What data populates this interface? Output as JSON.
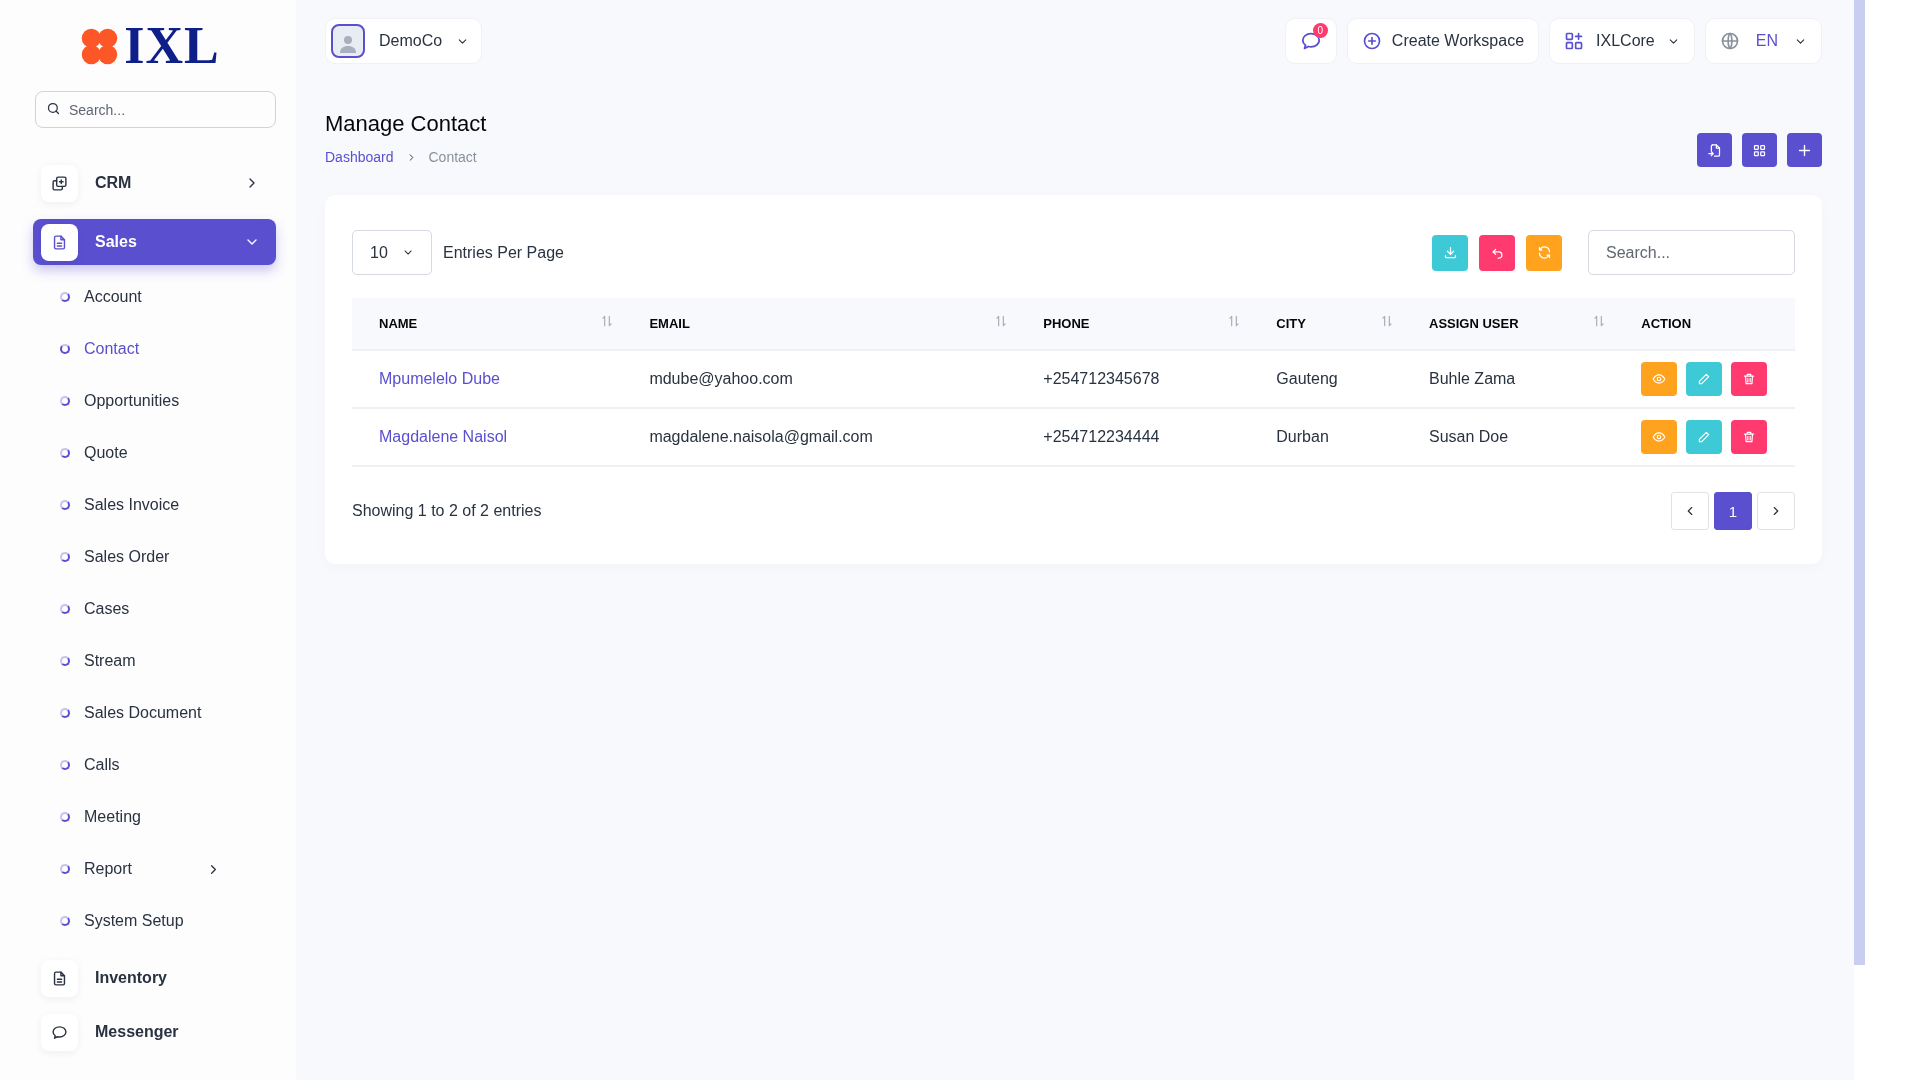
{
  "logo": {
    "text": "IXL"
  },
  "sidebar": {
    "search": {
      "placeholder": "Search..."
    },
    "items": [
      {
        "kind": "module",
        "label": "CRM",
        "selected": false,
        "expanded": false
      },
      {
        "kind": "module",
        "label": "Sales",
        "selected": true,
        "expanded": true,
        "children": [
          {
            "label": "Account",
            "selected": false,
            "has_submenu": false
          },
          {
            "label": "Contact",
            "selected": true,
            "has_submenu": false
          },
          {
            "label": "Opportunities",
            "selected": false,
            "has_submenu": false
          },
          {
            "label": "Quote",
            "selected": false,
            "has_submenu": false
          },
          {
            "label": "Sales Invoice",
            "selected": false,
            "has_submenu": false
          },
          {
            "label": "Sales Order",
            "selected": false,
            "has_submenu": false
          },
          {
            "label": "Cases",
            "selected": false,
            "has_submenu": false
          },
          {
            "label": "Stream",
            "selected": false,
            "has_submenu": false
          },
          {
            "label": "Sales Document",
            "selected": false,
            "has_submenu": false
          },
          {
            "label": "Calls",
            "selected": false,
            "has_submenu": false
          },
          {
            "label": "Meeting",
            "selected": false,
            "has_submenu": false
          },
          {
            "label": "Report",
            "selected": false,
            "has_submenu": true
          },
          {
            "label": "System Setup",
            "selected": false,
            "has_submenu": false
          }
        ]
      },
      {
        "kind": "module",
        "label": "Inventory",
        "selected": false
      },
      {
        "kind": "module",
        "label": "Messenger",
        "selected": false
      }
    ]
  },
  "topbar": {
    "workspace": "DemoCo",
    "notification_count": "0",
    "create_button": "Create Workspace",
    "app_switcher": "IXLCore",
    "language": "EN"
  },
  "page": {
    "title": "Manage Contact",
    "breadcrumb": [
      {
        "label": "Dashboard",
        "kind": "link"
      },
      {
        "label": "Contact",
        "kind": "current"
      }
    ]
  },
  "table": {
    "entries_per_page": "10",
    "entries_label": "Entries Per Page",
    "search": {
      "placeholder": "Search..."
    },
    "columns": [
      {
        "label": "NAME",
        "sortable": true
      },
      {
        "label": "EMAIL",
        "sortable": true
      },
      {
        "label": "PHONE",
        "sortable": true
      },
      {
        "label": "CITY",
        "sortable": true
      },
      {
        "label": "ASSIGN USER",
        "sortable": true
      },
      {
        "label": "ACTION",
        "sortable": false
      }
    ],
    "rows": [
      {
        "name": "Mpumelelo Dube",
        "email": "mdube@yahoo.com",
        "phone": "+254712345678",
        "city": "Gauteng",
        "assign_user": "Buhle Zama"
      },
      {
        "name": "Magdalene Naisol",
        "email": "magdalene.naisola@gmail.com",
        "phone": "+254712234444",
        "city": "Durban",
        "assign_user": "Susan Doe"
      }
    ],
    "footer": "Showing 1 to 2 of 2 entries",
    "pagination": {
      "pages": [
        {
          "label": "1",
          "selected": true
        }
      ]
    }
  }
}
